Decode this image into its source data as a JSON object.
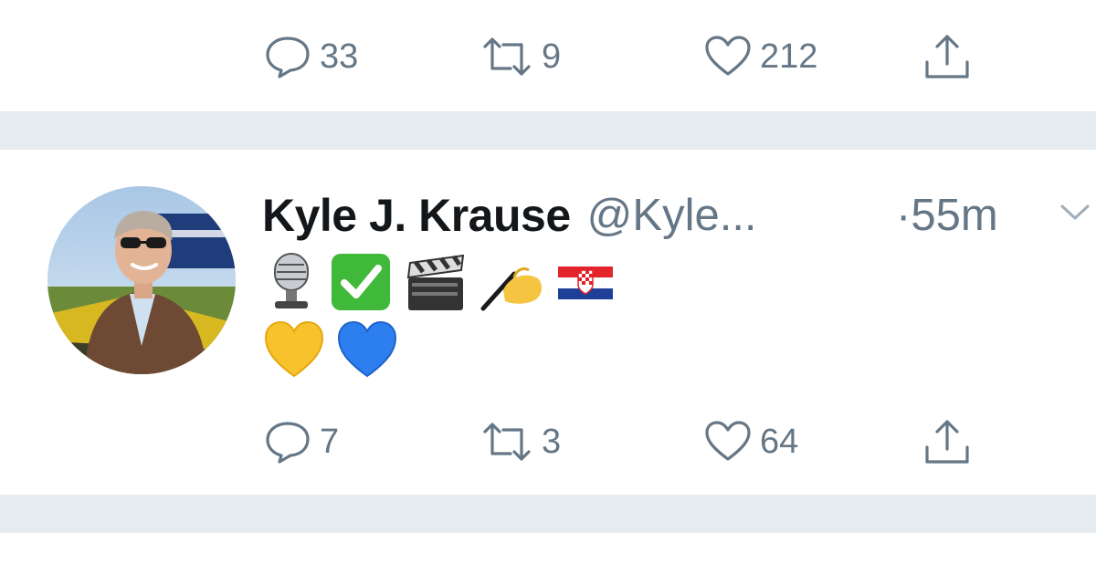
{
  "previous_tweet": {
    "reply_count": "33",
    "retweet_count": "9",
    "like_count": "212"
  },
  "tweet": {
    "display_name": "Kyle J. Krause",
    "handle": "@Kyle...",
    "time": "·55m",
    "body_emoji": [
      "studio-microphone",
      "check-mark-button",
      "clapper-board",
      "writing-hand",
      "flag-croatia",
      "yellow-heart",
      "blue-heart"
    ],
    "reply_count": "7",
    "retweet_count": "3",
    "like_count": "64"
  },
  "icons": {
    "reply": "reply-icon",
    "retweet": "retweet-icon",
    "like": "heart-icon",
    "share": "share-icon",
    "caret": "chevron-down-icon"
  },
  "colors": {
    "separator": "#e6ecf0",
    "meta_text": "#657786",
    "name_text": "#14171a"
  }
}
